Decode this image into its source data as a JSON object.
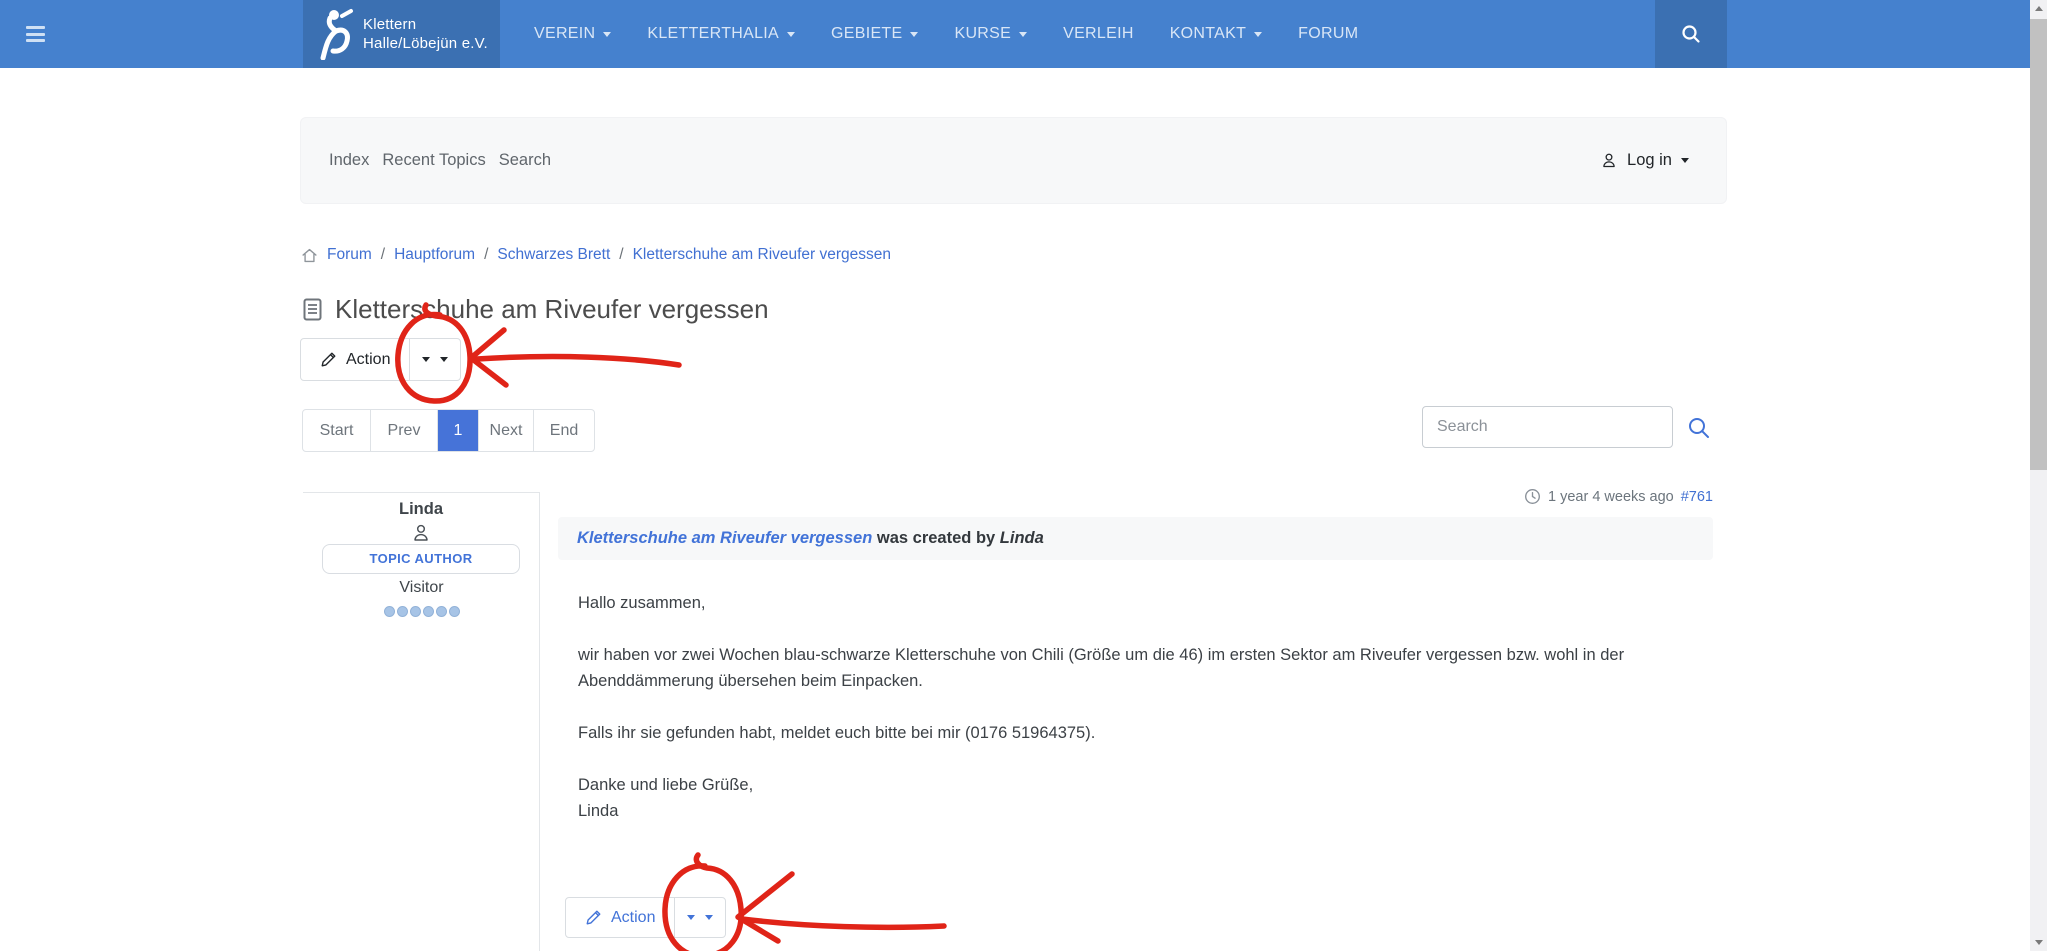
{
  "navbar": {
    "brand": {
      "line1": "Klettern",
      "line2": "Halle/Löbejün e.V."
    },
    "items": [
      {
        "label": "VEREIN",
        "dropdown": true
      },
      {
        "label": "KLETTERTHALIA",
        "dropdown": true
      },
      {
        "label": "GEBIETE",
        "dropdown": true
      },
      {
        "label": "KURSE",
        "dropdown": true
      },
      {
        "label": "VERLEIH",
        "dropdown": false
      },
      {
        "label": "KONTAKT",
        "dropdown": true
      },
      {
        "label": "FORUM",
        "dropdown": false
      }
    ]
  },
  "forum_menu": {
    "links": [
      "Index",
      "Recent Topics",
      "Search"
    ],
    "login_label": "Log in"
  },
  "breadcrumb": {
    "separator": "/",
    "items": [
      "Forum",
      "Hauptforum",
      "Schwarzes Brett",
      "Kletterschuhe am Riveufer vergessen"
    ]
  },
  "page": {
    "title": "Kletterschuhe am Riveufer vergessen"
  },
  "toolbar": {
    "action_label": "Action"
  },
  "pagination": {
    "items": [
      "Start",
      "Prev",
      "1",
      "Next",
      "End"
    ],
    "active": "1"
  },
  "search": {
    "placeholder": "Search"
  },
  "post": {
    "author": {
      "name": "Linda",
      "role_badge": "TOPIC AUTHOR",
      "rank": "Visitor",
      "karma_dots": 6
    },
    "meta": {
      "time_ago": "1 year 4 weeks ago",
      "post_id": "#761"
    },
    "header": {
      "subject": "Kletterschuhe am Riveufer vergessen",
      "created_text": " was created by ",
      "author": "Linda"
    },
    "body_lines": [
      "Hallo zusammen,",
      "",
      "wir haben vor zwei Wochen blau-schwarze Kletterschuhe von Chili (Größe um die 46) im ersten Sektor am Riveufer vergessen bzw. wohl in der",
      "Abenddämmerung übersehen beim Einpacken.",
      "",
      "Falls ihr sie gefunden habt, meldet euch bitte bei mir (0176 51964375).",
      "",
      "Danke und liebe Grüße,",
      "Linda"
    ],
    "action_label": "Action"
  },
  "icons": {
    "caret_down": "css-triangle",
    "hamburger": "three-bars",
    "search": "magnifier",
    "user": "person-outline",
    "clock": "clock-outline",
    "home": "house-outline",
    "document": "page-with-lines",
    "pencil": "pencil-outline"
  },
  "colors": {
    "navbar": "#4581ce",
    "navbar_dark": "#3b70b2",
    "link_blue": "#4170d2",
    "accent_blue": "#4273d8",
    "pagination_active": "#4673d8",
    "annotation_red": "#e02418",
    "card_bg": "#f7f8f9",
    "karma_dot": "#a7c4e6"
  }
}
